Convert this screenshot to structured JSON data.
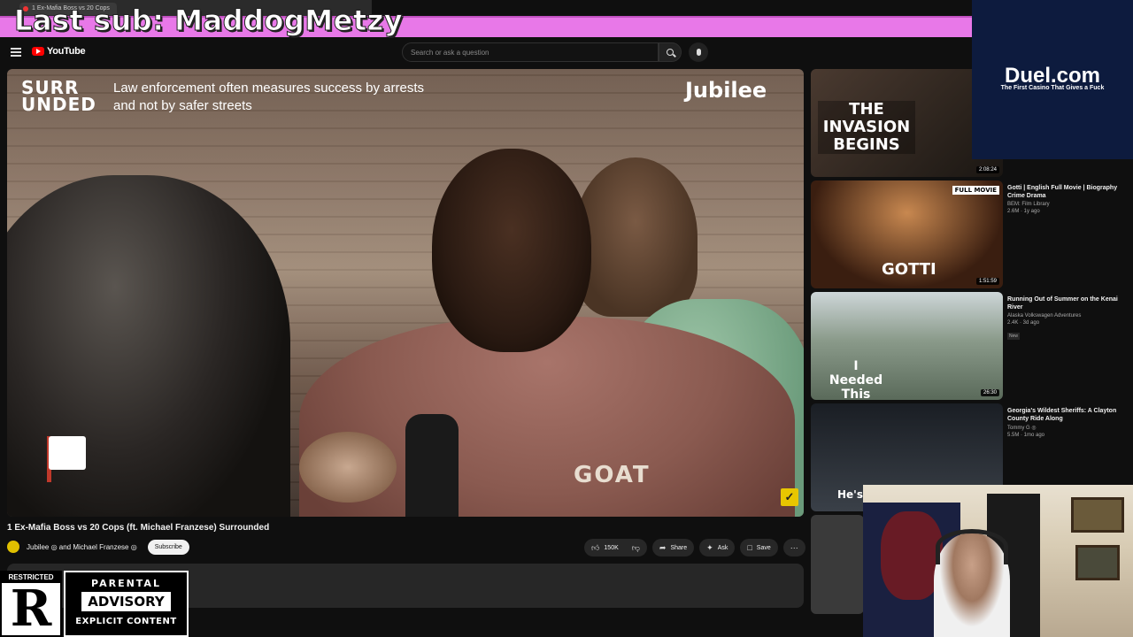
{
  "browser": {
    "tab_title": "1 Ex-Mafia Boss vs 20 Cops"
  },
  "overlay": {
    "last_sub": "Last sub: MaddogMetzy"
  },
  "header": {
    "logo_text": "YouTube",
    "search_placeholder": "Search or ask a question"
  },
  "video": {
    "channel_logo": "SURR\nUNDED",
    "caption": "Law enforcement often measures success by arrests and not by safer streets",
    "brand": "Jubilee",
    "shirt_text": "GOAT"
  },
  "watch": {
    "title": "1 Ex-Mafia Boss vs 20 Cops (ft. Michael Franzese) Surrounded",
    "channel": "Jubilee ◎ and Michael Franzese ◎",
    "subscribe": "Subscribe",
    "likes": "150K",
    "share": "Share",
    "ask": "Ask",
    "save": "Save"
  },
  "sidebar": {
    "items": [
      {
        "title": "",
        "channel": "",
        "views": "",
        "duration": "2:08:24",
        "thumb_text": "THE INVASION BEGINS",
        "thumb_bg": "#2a2420"
      },
      {
        "title": "Gotti | English Full Movie | Biography Crime Drama",
        "channel": "BEM: Film Library",
        "views": "2.6M · 1y ago",
        "duration": "1:51:59",
        "thumb_text": "GOTTI",
        "thumb_badge": "FULL MOVIE",
        "thumb_bg": "#3a1e10"
      },
      {
        "title": "Running Out of Summer on the Kenai River",
        "channel": "Alaska Volkswagen Adventures",
        "views": "2.4K · 3d ago",
        "badge": "New",
        "duration": "26:30",
        "thumb_text": "I Needed This Fish",
        "thumb_bg": "#7a8a7a"
      },
      {
        "title": "Georgia's Wildest Sheriffs: A Clayton County Ride Along",
        "channel": "Tommy G ◎",
        "views": "5.5M · 1mo ago",
        "duration": "",
        "thumb_text": "He's",
        "thumb_bg": "#2a2e34"
      }
    ]
  },
  "sponsor": {
    "name": "Duel.com",
    "tagline": "The First Casino That Gives a Fuck"
  },
  "stickers": {
    "restricted_label": "RESTRICTED",
    "restricted_letter": "R",
    "parental": "PARENTAL",
    "advisory": "ADVISORY",
    "explicit": "EXPLICIT CONTENT"
  }
}
